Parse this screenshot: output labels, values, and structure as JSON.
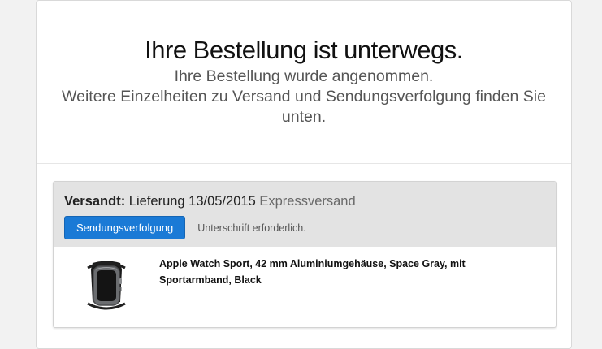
{
  "header": {
    "title": "Ihre Bestellung ist unterwegs.",
    "subtitle": "Ihre Bestellung wurde angenommen.",
    "details": "Weitere Einzelheiten zu Versand und Sendungsverfolgung finden Sie unten."
  },
  "shipment": {
    "status_label": "Versandt:",
    "delivery_text": "Lieferung 13/05/2015",
    "method": "Expressversand",
    "track_button": "Sendungsverfolgung",
    "signature_note": "Unterschrift erforderlich.",
    "items": [
      {
        "name": "Apple Watch Sport, 42 mm Aluminiumgehäuse, Space Gray, mit Sportarmband, Black",
        "icon": "apple-watch-image"
      }
    ]
  },
  "colors": {
    "accent": "#1a7ad6",
    "panel": "#e3e3e3"
  }
}
